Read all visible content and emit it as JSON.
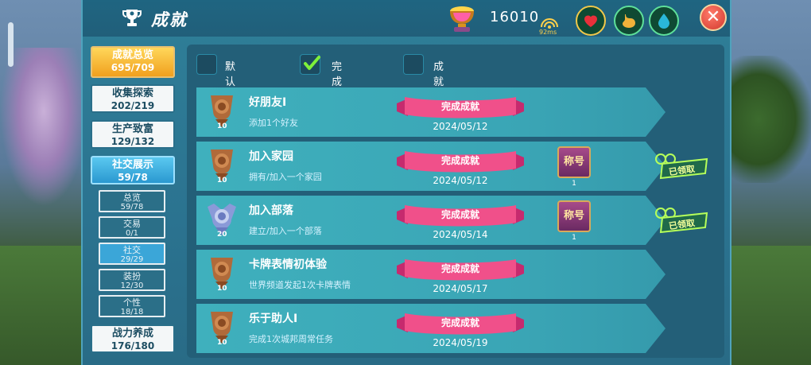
{
  "header": {
    "title": "成就",
    "score": "16010",
    "ping": "92ms",
    "stats": [
      {
        "icon": "heart-icon",
        "color": "#e8303a"
      },
      {
        "icon": "stomach-icon",
        "color": "#f0b23a"
      },
      {
        "icon": "water-drop-icon",
        "color": "#2ab8d8"
      }
    ]
  },
  "sidebar": {
    "items": [
      {
        "label": "成就总览",
        "count": "695/709",
        "style": "gold"
      },
      {
        "label": "收集探索",
        "count": "202/219"
      },
      {
        "label": "生产致富",
        "count": "129/132"
      },
      {
        "label": "社交展示",
        "count": "59/78",
        "style": "active"
      },
      {
        "label": "战力养成",
        "count": "176/180"
      }
    ],
    "subitems": [
      {
        "label": "总览",
        "count": "59/78"
      },
      {
        "label": "交易",
        "count": "0/1"
      },
      {
        "label": "社交",
        "count": "29/29",
        "active": true
      },
      {
        "label": "装扮",
        "count": "12/30"
      },
      {
        "label": "个性",
        "count": "18/18"
      }
    ]
  },
  "sort": {
    "options": [
      {
        "label": "默认排序",
        "checked": false
      },
      {
        "label": "完成度排序",
        "checked": true
      },
      {
        "label": "成就点排序",
        "checked": false
      }
    ]
  },
  "achievements": [
    {
      "title": "好朋友Ⅰ",
      "desc": "添加1个好友",
      "points": "10",
      "medal": "bronze",
      "status": "完成成就",
      "date": "2024/05/12",
      "reward": null
    },
    {
      "title": "加入家园",
      "desc": "拥有/加入一个家园",
      "points": "10",
      "medal": "bronze",
      "status": "完成成就",
      "date": "2024/05/12",
      "reward": {
        "label": "称号",
        "count": "1",
        "claimed": "已领取"
      }
    },
    {
      "title": "加入部落",
      "desc": "建立/加入一个部落",
      "points": "20",
      "medal": "silver",
      "status": "完成成就",
      "date": "2024/05/14",
      "reward": {
        "label": "称号",
        "count": "1",
        "claimed": "已领取"
      }
    },
    {
      "title": "卡牌表情初体验",
      "desc": "世界频道发起1次卡牌表情",
      "points": "10",
      "medal": "bronze",
      "status": "完成成就",
      "date": "2024/05/17",
      "reward": null
    },
    {
      "title": "乐于助人Ⅰ",
      "desc": "完成1次城邦周常任务",
      "points": "10",
      "medal": "bronze",
      "status": "完成成就",
      "date": "2024/05/19",
      "reward": null
    }
  ]
}
